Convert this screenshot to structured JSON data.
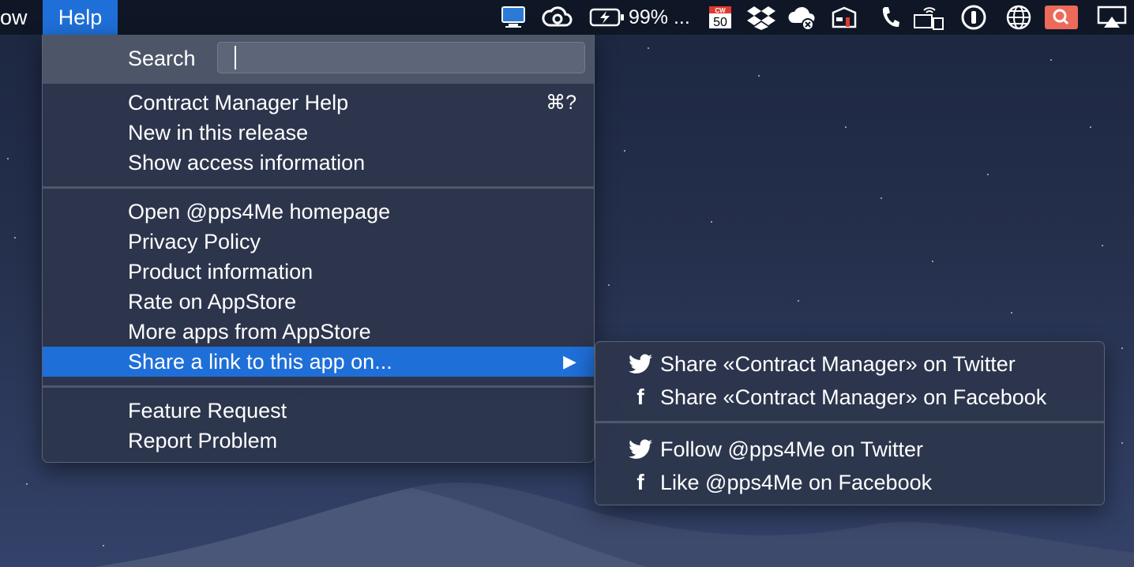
{
  "menubar": {
    "window_label": "ow",
    "help_label": "Help",
    "battery_text": "99% ..."
  },
  "status_icons": [
    "screen-share-icon",
    "creative-cloud-icon",
    "battery-icon",
    "cw50-calendar-icon",
    "dropbox-icon",
    "cloud-error-icon",
    "backup-icon",
    "phone-icon",
    "wifi-display-icon",
    "password-manager-icon",
    "globe-icon",
    "search-app-icon",
    "airplay-icon"
  ],
  "menu": {
    "search_label": "Search",
    "search_value": "",
    "items": [
      {
        "label": "Contract Manager Help",
        "shortcut": "⌘?"
      },
      {
        "label": "New in this release"
      },
      {
        "label": "Show access information"
      },
      {
        "label": "Open @pps4Me homepage"
      },
      {
        "label": "Privacy Policy"
      },
      {
        "label": "Product information"
      },
      {
        "label": "Rate on AppStore"
      },
      {
        "label": "More apps from AppStore"
      },
      {
        "label": "Share a link to this app on..."
      },
      {
        "label": "Feature Request"
      },
      {
        "label": "Report Problem"
      }
    ],
    "submenu_arrow": "▶"
  },
  "submenu": {
    "items": [
      {
        "label": "Share «Contract Manager» on Twitter",
        "icon": "twitter-icon"
      },
      {
        "label": "Share «Contract Manager» on Facebook",
        "icon": "facebook-icon"
      },
      {
        "label": "Follow @pps4Me on Twitter",
        "icon": "twitter-icon"
      },
      {
        "label": "Like @pps4Me on Facebook",
        "icon": "facebook-icon"
      }
    ],
    "facebook_glyph": "f"
  },
  "colors": {
    "highlight": "#1f6fd8",
    "menu_bg": "#2c364c",
    "menubar_bg": "#0f1726"
  }
}
